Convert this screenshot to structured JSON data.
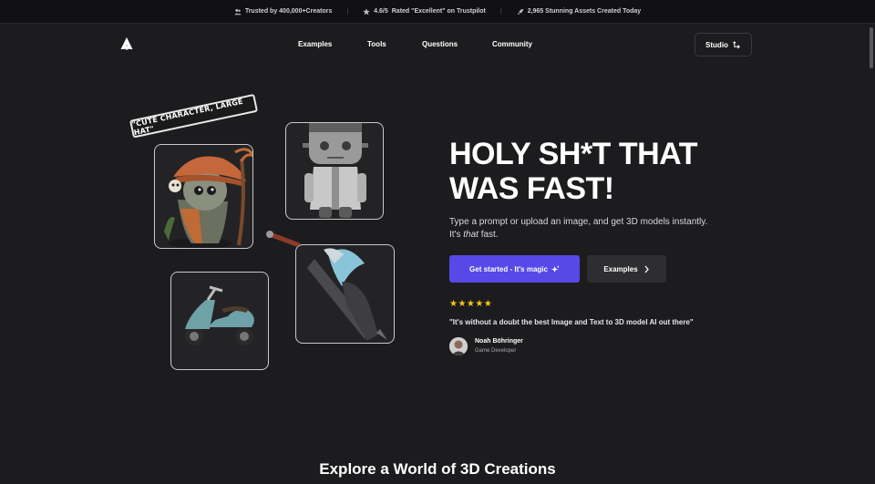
{
  "topbar": {
    "trusted": "Trusted by 400,000+Creators",
    "rating": "4.6/5",
    "rating_text": "Rated \"Excellent\" on Trustpilot",
    "assets": "2,965 Stunning Assets Created Today",
    "separator": "|"
  },
  "nav": {
    "links": [
      "Examples",
      "Tools",
      "Questions",
      "Community"
    ],
    "studio_label": "Studio"
  },
  "showcase": {
    "prompt_tag": "\"CUTE CHARACTER, LARGE HAT\""
  },
  "hero": {
    "title_line1": "HOLY SH*T THAT",
    "title_line2": "WAS FAST!",
    "subtitle_part1": "Type a prompt or upload an image, and get 3D models instantly.",
    "subtitle_part2": "It's ",
    "subtitle_emph": "that",
    "subtitle_part3": " fast.",
    "cta_primary": "Get started - It's magic",
    "cta_secondary": "Examples"
  },
  "testimonial": {
    "stars": "★★★★★",
    "quote": "\"It's without a doubt the best Image and Text to 3D model AI out there\"",
    "author": "Noah Böhringer",
    "role": "Game Developer"
  },
  "section": {
    "title": "Explore a World of 3D Creations"
  },
  "colors": {
    "background": "#1c1c1e",
    "accent": "#5749e8",
    "star": "#f5c518"
  }
}
